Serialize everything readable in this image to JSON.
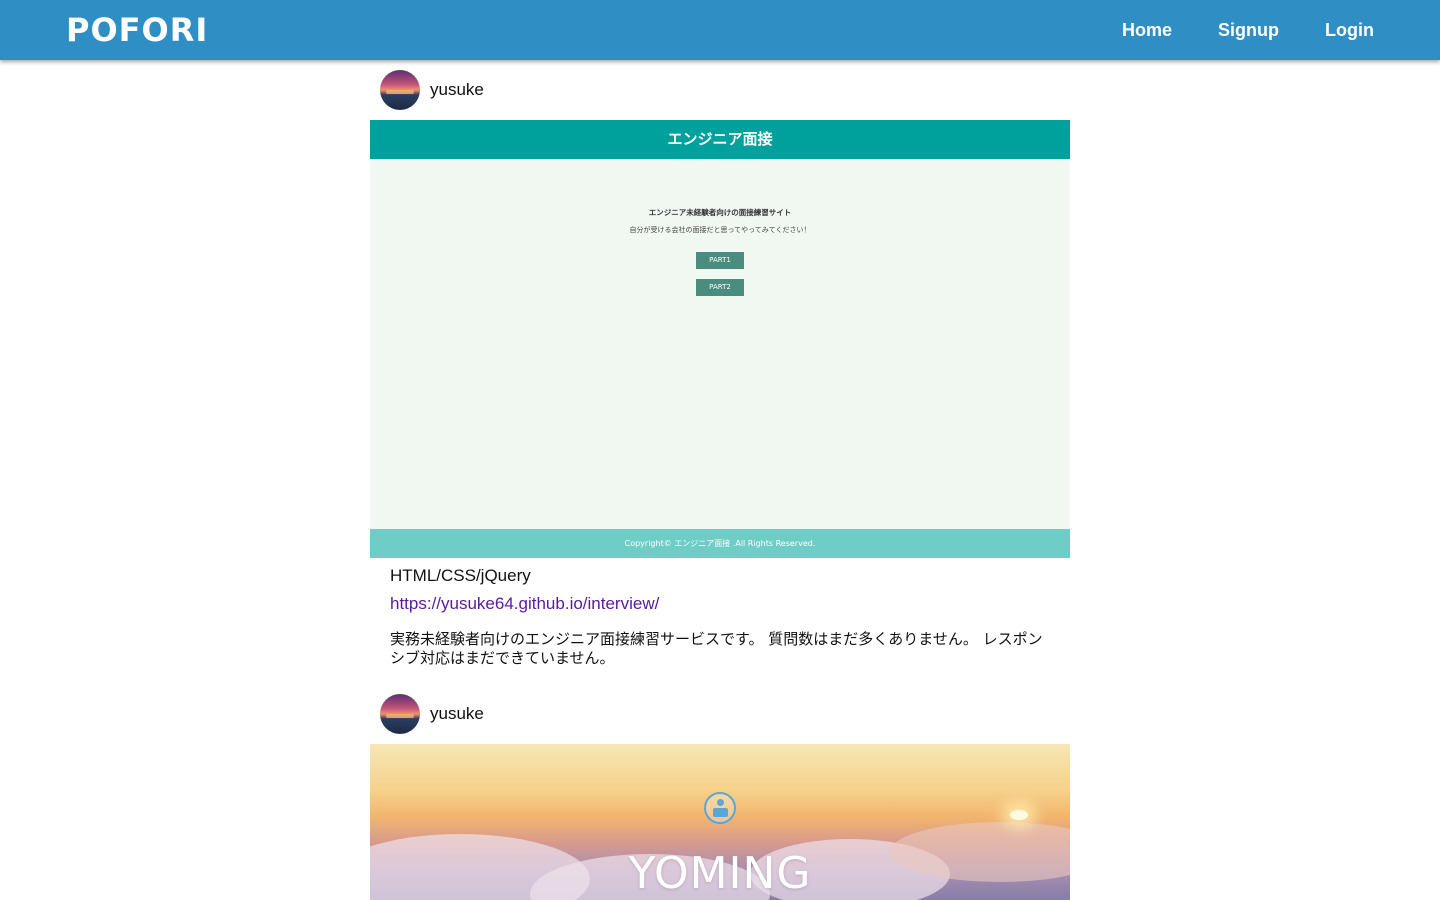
{
  "navbar": {
    "brand": "POFORI",
    "links": [
      "Home",
      "Signup",
      "Login"
    ]
  },
  "posts": [
    {
      "username": "yusuke",
      "screenshot": {
        "header": "エンジニア面接",
        "title": "エンジニア未経験者向けの面接練習サイト",
        "subtitle": "自分が受ける会社の面接だと思ってやってみてください！",
        "buttons": [
          "PART1",
          "PART2"
        ],
        "footer": "Copyright© エンジニア面接 .All Rights Reserved."
      },
      "tech": "HTML/CSS/jQuery",
      "url": "https://yusuke64.github.io/interview/",
      "description": "実務未経験者向けのエンジニア面接練習サービスです。 質問数はまだ多くありません。 レスポンシブ対応はまだできていません。"
    },
    {
      "username": "yusuke",
      "screenshot": {
        "title": "YOMING",
        "icon": "reader-icon"
      }
    }
  ]
}
